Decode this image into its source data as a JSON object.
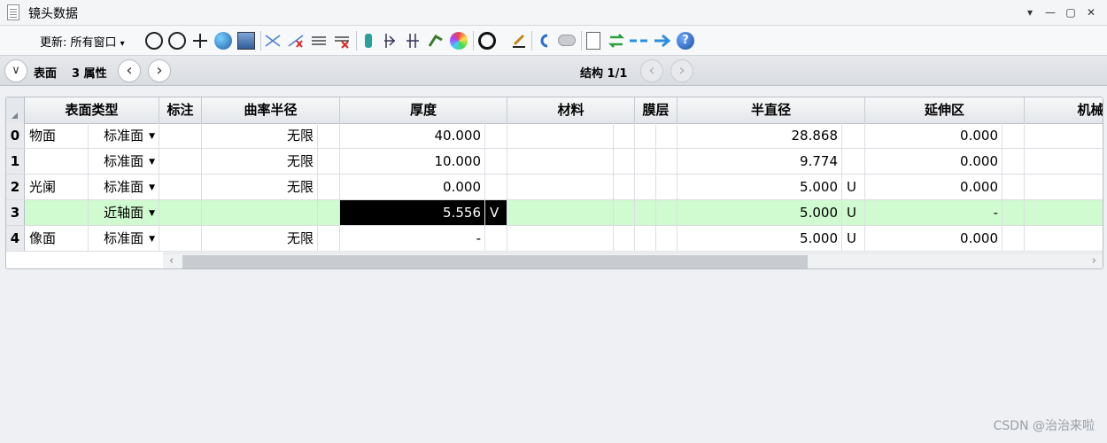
{
  "window": {
    "title": "镜头数据",
    "controls": {
      "menu": "▾",
      "minimize": "—",
      "maximize": "▢",
      "close": "✕"
    }
  },
  "toolbar": {
    "update_label": "更新: 所有窗口",
    "update_arrow": "▾",
    "icons": [
      "refresh-icon",
      "auto-refresh-icon",
      "move-icon",
      "globe-icon",
      "image-icon",
      "ray-icon",
      "ray-x-icon",
      "wave-icon",
      "wave-x-icon",
      "lens-group-icon",
      "lens-split-icon",
      "lens-join-icon",
      "flag-icon",
      "palette-icon",
      "circle-icon",
      "edit-icon",
      "undo-icon",
      "toggle-icon",
      "sheet-icon",
      "swap-icon",
      "arrows-in-icon",
      "arrow-right-icon",
      "help-icon"
    ]
  },
  "nav": {
    "surface_label": "表面",
    "attr_label": "3 属性",
    "struct_label": "结构 1/1",
    "down_glyph": "∨",
    "prev_glyph": "‹",
    "next_glyph": "›"
  },
  "grid": {
    "columns": [
      "表面类型",
      "标注",
      "曲率半径",
      "厚度",
      "材料",
      "膜层",
      "半直径",
      "延伸区",
      "机械"
    ],
    "rows": [
      {
        "num": "0",
        "name": "物面",
        "type": "标准面",
        "radius": "无限",
        "thickness": "40.000",
        "th_flag": "",
        "semi": "28.868",
        "semi_flag": "",
        "ext": "0.000"
      },
      {
        "num": "1",
        "name": "",
        "type": "标准面",
        "radius": "无限",
        "thickness": "10.000",
        "th_flag": "",
        "semi": "9.774",
        "semi_flag": "",
        "ext": "0.000"
      },
      {
        "num": "2",
        "name": "光阑",
        "type": "标准面",
        "radius": "无限",
        "thickness": "0.000",
        "th_flag": "",
        "semi": "5.000",
        "semi_flag": "U",
        "ext": "0.000"
      },
      {
        "num": "3",
        "name": "",
        "type": "近轴面",
        "radius": "",
        "thickness": "5.556",
        "th_flag": "V",
        "semi": "5.000",
        "semi_flag": "U",
        "ext": "-"
      },
      {
        "num": "4",
        "name": "像面",
        "type": "标准面",
        "radius": "无限",
        "thickness": "-",
        "th_flag": "",
        "semi": "5.000",
        "semi_flag": "U",
        "ext": "0.000"
      }
    ],
    "dropdown_glyph": "▼"
  },
  "scroll": {
    "left": "‹",
    "right": "›"
  },
  "watermark": "CSDN @治治来啦"
}
